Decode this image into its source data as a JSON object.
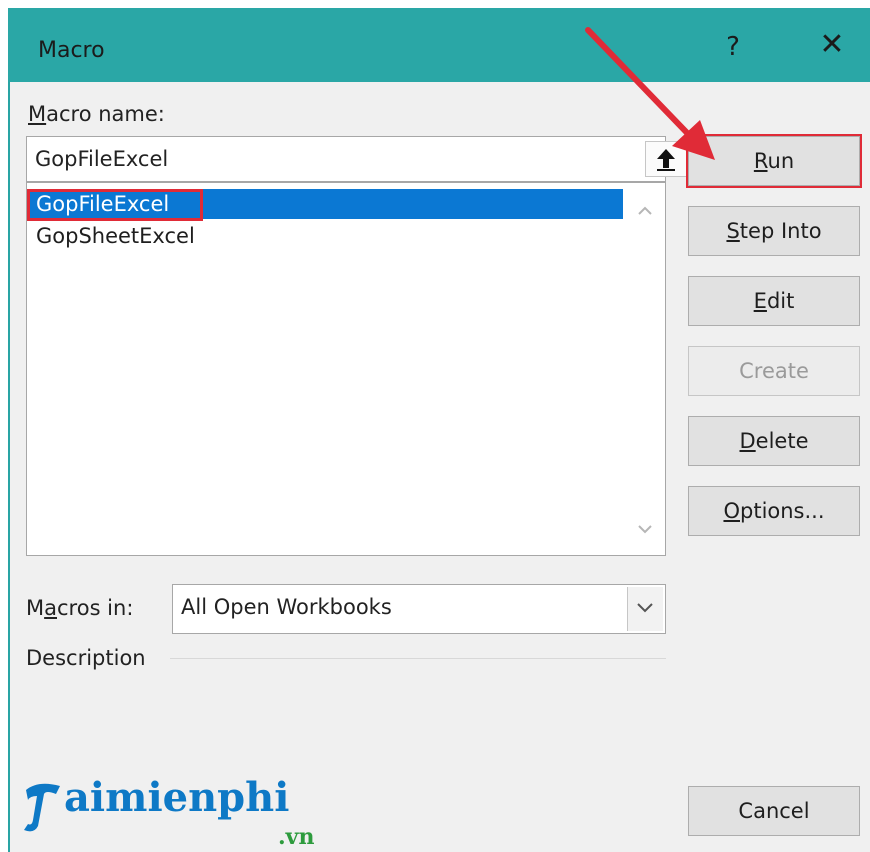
{
  "dialog": {
    "title": "Macro",
    "help_glyph": "?",
    "close_glyph": "✕"
  },
  "macro_name": {
    "label_first": "M",
    "label_rest": "acro name:",
    "value": "GopFileExcel"
  },
  "macro_list": {
    "items": [
      "GopFileExcel",
      "GopSheetExcel"
    ],
    "selected": "GopFileExcel"
  },
  "buttons": {
    "run": {
      "hot": "R",
      "rest": "un"
    },
    "step_into": {
      "hot": "S",
      "rest": "tep Into"
    },
    "edit": {
      "hot": "E",
      "rest": "dit"
    },
    "create": {
      "label": "Create"
    },
    "delete": {
      "hot": "D",
      "rest": "elete"
    },
    "options": {
      "hot": "O",
      "rest": "ptions..."
    },
    "cancel": {
      "label": "Cancel"
    }
  },
  "macros_in": {
    "label_a": "M",
    "label_hot": "a",
    "label_rest": "cros in:",
    "value": "All Open Workbooks"
  },
  "description": {
    "label": "Description"
  },
  "watermark": {
    "brand": "aimienphi",
    "tld": ".vn"
  },
  "colors": {
    "titlebar": "#2aa7a6",
    "selection": "#0b78d3",
    "annotation": "#e02b37"
  }
}
